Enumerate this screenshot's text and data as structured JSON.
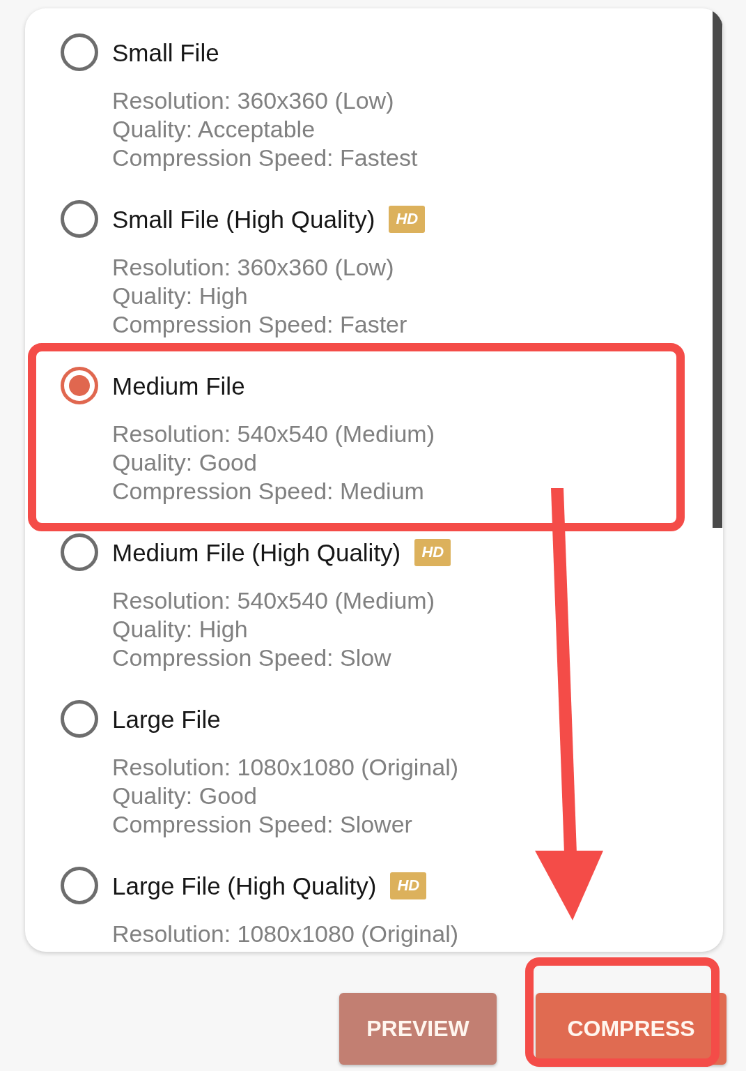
{
  "options": [
    {
      "title": "Small File",
      "selected": false,
      "highlighted": false,
      "details": [
        "Resolution: 360x360 (Low)",
        "Quality: Acceptable",
        "Compression Speed: Fastest"
      ]
    },
    {
      "title": "Small File (High Quality)",
      "badge": "HD",
      "selected": false,
      "highlighted": false,
      "details": [
        "Resolution: 360x360 (Low)",
        "Quality: High",
        "Compression Speed: Faster"
      ]
    },
    {
      "title": "Medium File",
      "selected": true,
      "highlighted": true,
      "details": [
        "Resolution: 540x540 (Medium)",
        "Quality: Good",
        "Compression Speed: Medium"
      ]
    },
    {
      "title": "Medium File (High Quality)",
      "badge": "HD",
      "selected": false,
      "highlighted": false,
      "details": [
        "Resolution: 540x540 (Medium)",
        "Quality: High",
        "Compression Speed: Slow"
      ]
    },
    {
      "title": "Large File",
      "selected": false,
      "highlighted": false,
      "details": [
        "Resolution: 1080x1080 (Original)",
        "Quality: Good",
        "Compression Speed: Slower"
      ]
    },
    {
      "title": "Large File (High Quality)",
      "badge": "HD",
      "selected": false,
      "highlighted": false,
      "details": [
        "Resolution: 1080x1080 (Original)"
      ]
    }
  ],
  "buttons": [
    {
      "label": "PREVIEW",
      "kind": "secondary",
      "highlighted": false
    },
    {
      "label": "COMPRESS",
      "kind": "primary",
      "highlighted": true
    }
  ],
  "arrow_annotation": true
}
